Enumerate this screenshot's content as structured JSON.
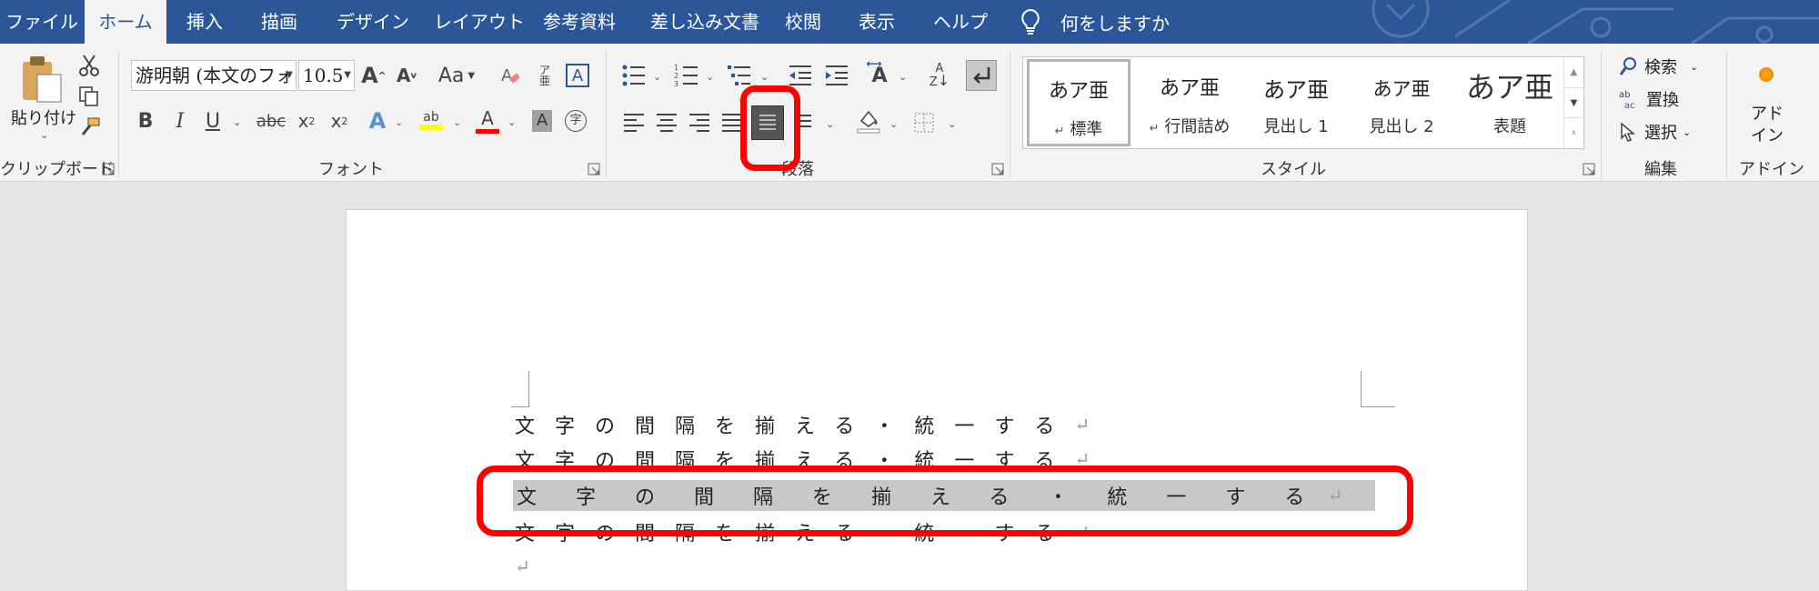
{
  "tabs": [
    "ファイル",
    "ホーム",
    "挿入",
    "描画",
    "デザイン",
    "レイアウト",
    "参考資料",
    "差し込み文書",
    "校閲",
    "表示",
    "ヘルプ"
  ],
  "active_tab": "ホーム",
  "tell_me": "何をしますか",
  "clipboard": {
    "paste": "貼り付け",
    "group": "クリップボード"
  },
  "font": {
    "name": "游明朝 (本文のフォ",
    "size": "10.5",
    "case": "Aa",
    "group": "フォント"
  },
  "paragraph": {
    "group": "段落"
  },
  "styles": {
    "group": "スタイル",
    "items": [
      {
        "sample": "あア亜",
        "name": "標準",
        "mark": "↵"
      },
      {
        "sample": "あア亜",
        "name": "行間詰め",
        "mark": "↵"
      },
      {
        "sample": "あア亜",
        "name": "見出し 1"
      },
      {
        "sample": "あア亜",
        "name": "見出し 2"
      },
      {
        "sample": "あア亜",
        "name": "表題"
      }
    ]
  },
  "editing": {
    "find": "検索",
    "replace": "置換",
    "select": "選択",
    "group": "編集"
  },
  "addins": {
    "label": "アド\nイン",
    "group": "アドイン"
  },
  "document": {
    "lines": [
      "文字の間隔を揃える・統一する",
      "文字の間隔を揃える・統一する",
      "文字の間隔を揃える・統一する",
      "文字の間隔を揃える・統一する"
    ],
    "paragraph_mark": "↵"
  },
  "colors": {
    "ribbon_blue": "#2b579a",
    "highlight_red": "#ff0000",
    "selection_gray": "#c8c8c8"
  }
}
